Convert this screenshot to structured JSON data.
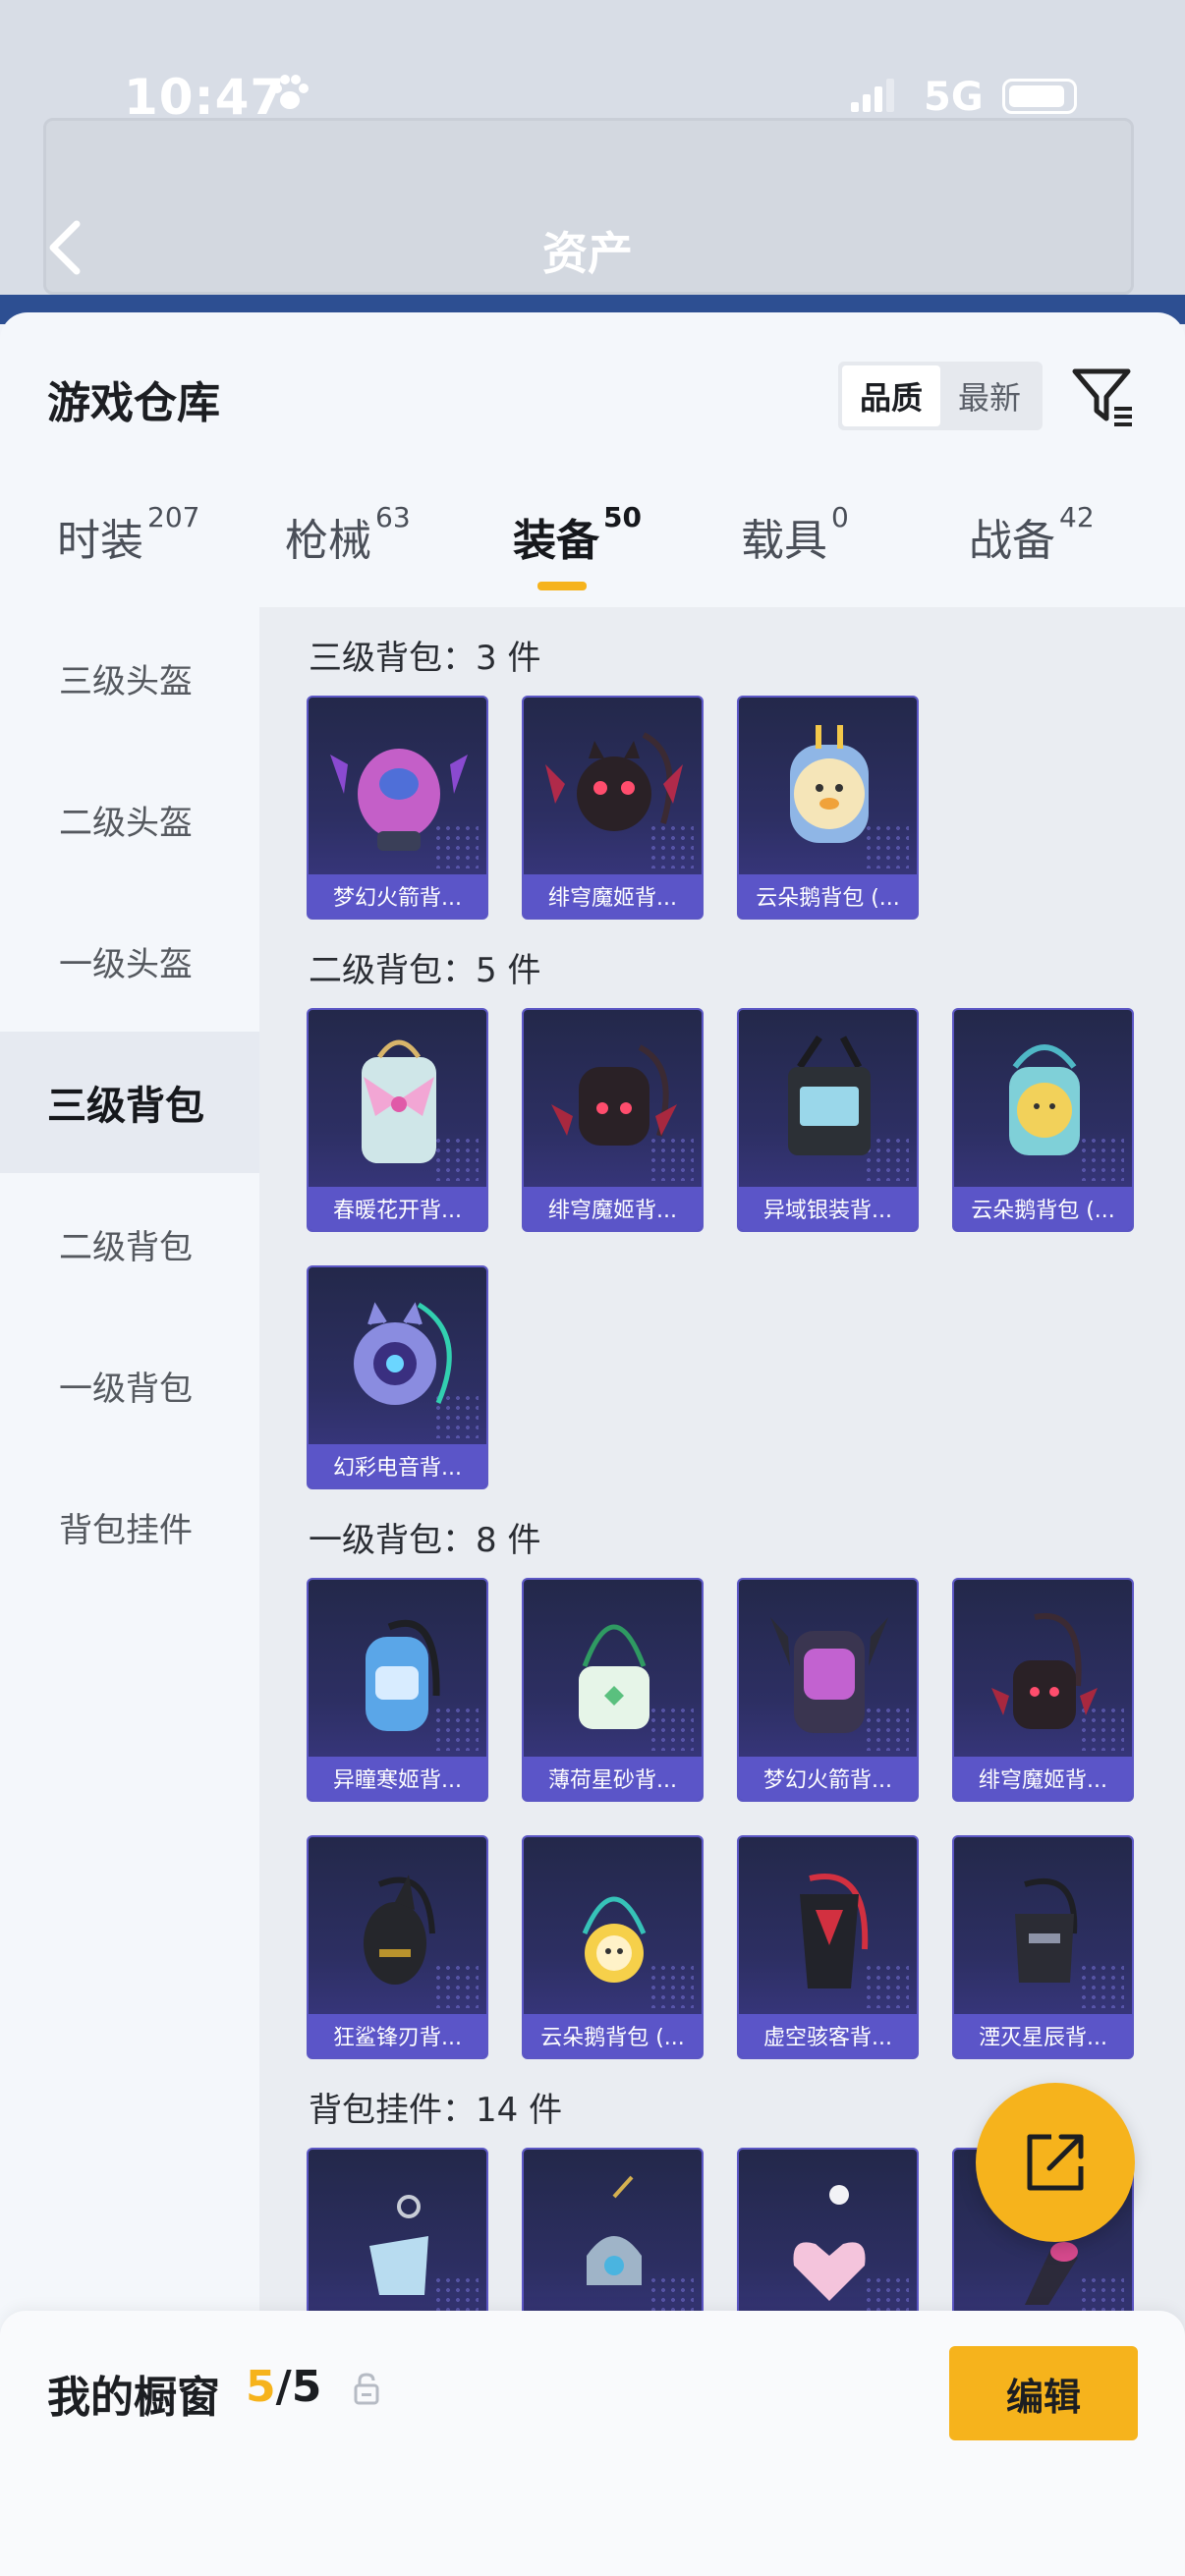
{
  "status_bar": {
    "time": "10:47",
    "network": "5G"
  },
  "header": {
    "title": "资产"
  },
  "sheet": {
    "title": "游戏仓库",
    "sort": {
      "options": [
        "品质",
        "最新"
      ],
      "selected": "品质"
    }
  },
  "tabs": [
    {
      "label": "时装",
      "count": "207"
    },
    {
      "label": "枪械",
      "count": "63"
    },
    {
      "label": "装备",
      "count": "50"
    },
    {
      "label": "载具",
      "count": "0"
    },
    {
      "label": "战备",
      "count": "42"
    }
  ],
  "active_tab": "装备",
  "side_nav": [
    {
      "label": "三级头盔"
    },
    {
      "label": "二级头盔"
    },
    {
      "label": "一级头盔"
    },
    {
      "label": "三级背包"
    },
    {
      "label": "二级背包"
    },
    {
      "label": "一级背包"
    },
    {
      "label": "背包挂件"
    }
  ],
  "active_nav": "三级背包",
  "sections": [
    {
      "title": "三级背包：3 件",
      "items": [
        "梦幻火箭背...",
        "绯穹魔姬背...",
        "云朵鹅背包 (..."
      ]
    },
    {
      "title": "二级背包：5 件",
      "items": [
        "春暖花开背...",
        "绯穹魔姬背...",
        "异域银装背...",
        "云朵鹅背包 (...",
        "幻彩电音背..."
      ]
    },
    {
      "title": "一级背包：8 件",
      "items": [
        "异瞳寒姬背...",
        "薄荷星砂背...",
        "梦幻火箭背...",
        "绯穹魔姬背...",
        "狂鲨锋刃背...",
        "云朵鹅背包 (...",
        "虚空骇客背...",
        "湮灭星辰背..."
      ]
    },
    {
      "title": "背包挂件：14 件",
      "items": [
        "",
        "",
        "",
        ""
      ]
    }
  ],
  "colors": {
    "accent": "#f6b31c",
    "card_label": "#5b55c8",
    "card_border": "#5c57c5"
  },
  "bottom_bar": {
    "label": "我的橱窗",
    "current": "5",
    "total": "/5",
    "edit_label": "编辑"
  }
}
